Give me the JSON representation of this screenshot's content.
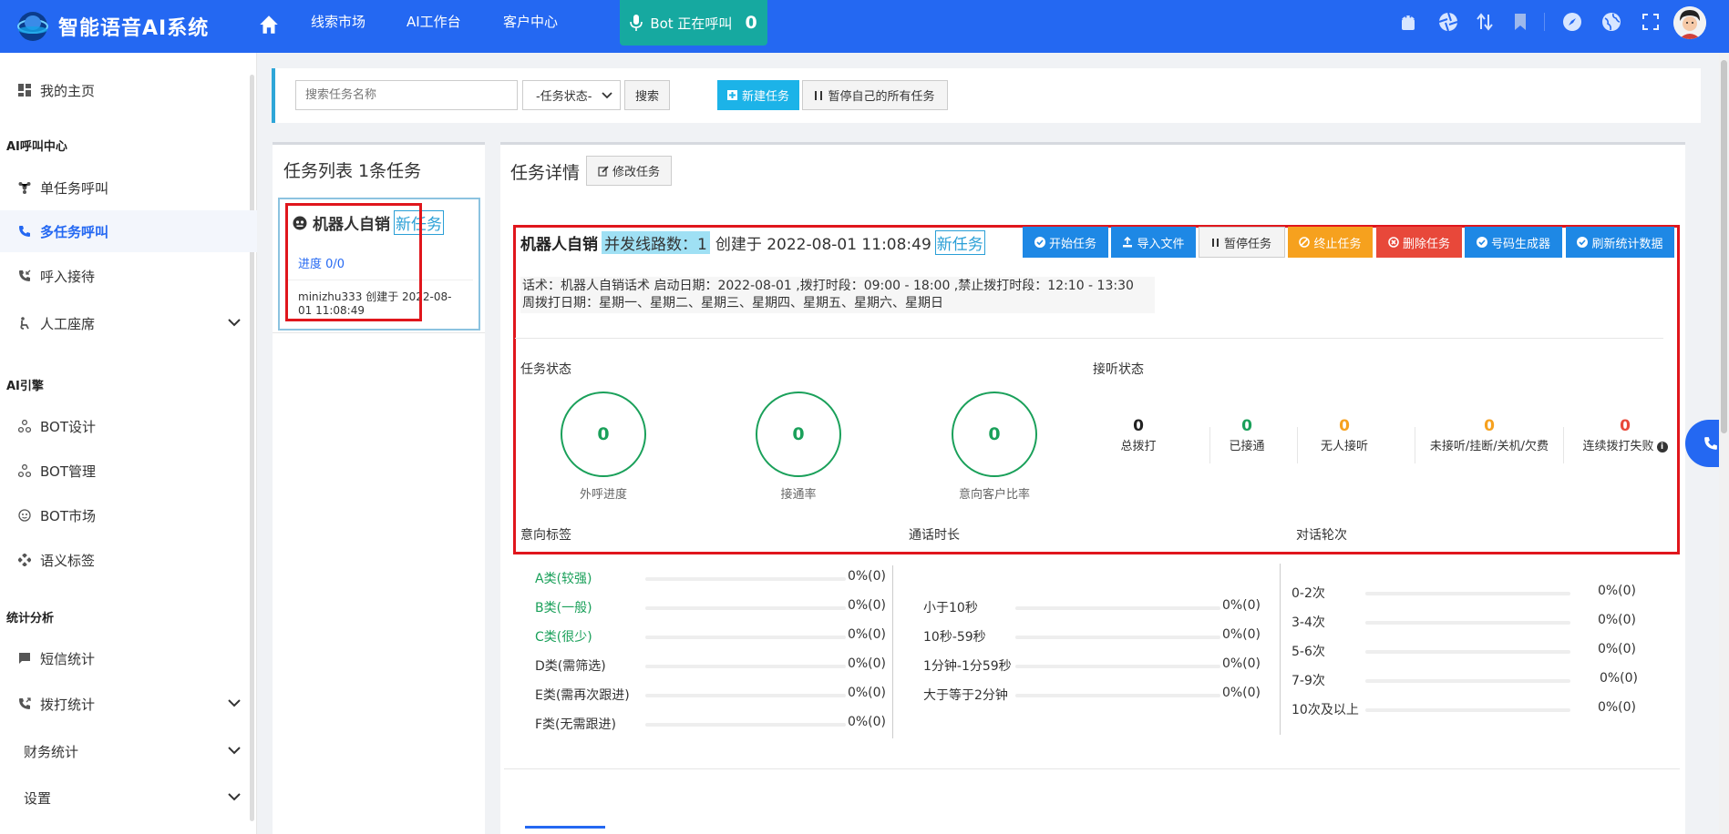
{
  "app": {
    "title": "智能语音AI系统"
  },
  "topnav": {
    "items": [
      "线索市场",
      "AI工作台",
      "客户中心"
    ]
  },
  "bot_status": {
    "label": "Bot 正在呼叫",
    "count": "0"
  },
  "colors": {
    "primary": "#2468f2",
    "success": "#1aa05a",
    "warning": "#f6a11e",
    "danger": "#e8483a",
    "highlight_box": "#e0161c",
    "cyan": "#1cb3e8"
  },
  "top_icons": [
    "android-icon",
    "aperture-icon",
    "transfer-icon",
    "bookmark-icon",
    "compass-icon",
    "globe-icon",
    "fullscreen-icon"
  ],
  "sidebar": {
    "home": "我的主页",
    "sections": {
      "call_center": "AI呼叫中心",
      "engine": "AI引擎",
      "stats": "统计分析"
    },
    "items": {
      "single_call": "单任务呼叫",
      "multi_call": "多任务呼叫",
      "inbound": "呼入接待",
      "agent_seat": "人工座席",
      "bot_design": "BOT设计",
      "bot_manage": "BOT管理",
      "bot_market": "BOT市场",
      "semantic_tags": "语义标签",
      "sms_stats": "短信统计",
      "dial_stats": "拨打统计",
      "finance_stats": "财务统计",
      "settings": "设置"
    }
  },
  "toolbar": {
    "search_placeholder": "搜索任务名称",
    "status_select": "-任务状态-",
    "search_btn": "搜索",
    "new_task_btn": "新建任务",
    "pause_all_btn": "暂停自己的所有任务"
  },
  "task_list": {
    "title": "任务列表 1条任务",
    "card": {
      "name": "机器人自销",
      "tag": "新任务",
      "progress": "进度 0/0",
      "meta": "minizhu333 创建于 2022-08-01 11:08:49"
    }
  },
  "detail": {
    "title": "任务详情",
    "edit_btn": "修改任务",
    "task_name": "机器人自销",
    "concurrency": "并发线路数：1",
    "created": "创建于 2022-08-01 11:08:49",
    "tag": "新任务",
    "actions": {
      "start": "开始任务",
      "import": "导入文件",
      "pause": "暂停任务",
      "stop": "终止任务",
      "delete": "删除任务",
      "numgen": "号码生成器",
      "refresh": "刷新统计数据"
    },
    "script_line1": "话术：机器人自销话术 启动日期：2022-08-01 ,拨打时段：09:00 - 18:00 ,禁止拨打时段：12:10 - 13:30",
    "script_line2": "周拨打日期：星期一、星期二、星期三、星期四、星期五、星期六、星期日",
    "task_status_label": "任务状态",
    "answer_status_label": "接听状态",
    "rings": [
      {
        "value": "0",
        "label": "外呼进度"
      },
      {
        "value": "0",
        "label": "接通率"
      },
      {
        "value": "0",
        "label": "意向客户比率"
      }
    ],
    "answer_stats": [
      {
        "value": "0",
        "label": "总拨打",
        "color": "#222222"
      },
      {
        "value": "0",
        "label": "已接通",
        "color": "#1aa05a"
      },
      {
        "value": "0",
        "label": "无人接听",
        "color": "#f6a11e"
      },
      {
        "value": "0",
        "label": "未接听/挂断/关机/欠费",
        "color": "#f6a11e"
      },
      {
        "value": "0",
        "label": "连续拨打失败",
        "color": "#e8483a"
      }
    ],
    "intent_label": "意向标签",
    "duration_label": "通话时长",
    "rounds_label": "对话轮次",
    "intent_rows": [
      {
        "label": "A类(较强)",
        "value": "0%(0)"
      },
      {
        "label": "B类(一般)",
        "value": "0%(0)"
      },
      {
        "label": "C类(很少)",
        "value": "0%(0)"
      },
      {
        "label": "D类(需筛选)",
        "value": "0%(0)"
      },
      {
        "label": "E类(需再次跟进)",
        "value": "0%(0)"
      },
      {
        "label": "F类(无需跟进)",
        "value": "0%(0)"
      }
    ],
    "duration_rows": [
      {
        "label": "小于10秒",
        "value": "0%(0)"
      },
      {
        "label": "10秒-59秒",
        "value": "0%(0)"
      },
      {
        "label": "1分钟-1分59秒",
        "value": "0%(0)"
      },
      {
        "label": "大于等于2分钟",
        "value": "0%(0)"
      }
    ],
    "rounds_rows": [
      {
        "label": "0-2次",
        "value": "0%(0)"
      },
      {
        "label": "3-4次",
        "value": "0%(0)"
      },
      {
        "label": "5-6次",
        "value": "0%(0)"
      },
      {
        "label": "7-9次",
        "value": "0%(0)"
      },
      {
        "label": "10次及以上",
        "value": "0%(0)"
      }
    ]
  }
}
